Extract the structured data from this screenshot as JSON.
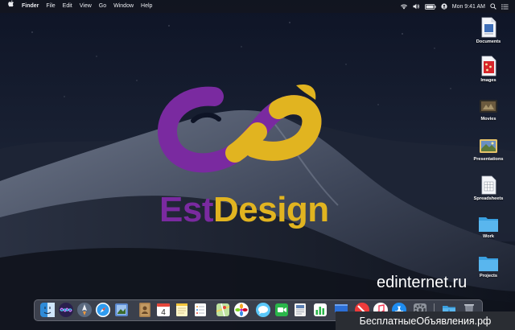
{
  "menubar": {
    "apple_icon": "apple-icon",
    "items": [
      "Finder",
      "File",
      "Edit",
      "View",
      "Go",
      "Window",
      "Help"
    ],
    "clock": "Mon 9:41 AM"
  },
  "desktop": {
    "icons": [
      {
        "label": "Documents"
      },
      {
        "label": "Images"
      },
      {
        "label": "Movies"
      },
      {
        "label": "Presentations"
      },
      {
        "label": "Spreadsheets"
      },
      {
        "label": "Work"
      },
      {
        "label": "Projects"
      }
    ]
  },
  "logo": {
    "part1": "Est",
    "part2": "Design",
    "colors": {
      "purple": "#7a2aa0",
      "gold": "#e1b420"
    }
  },
  "site_text": "edinternet.ru",
  "dock": {
    "apps": [
      "finder-icon",
      "siri-icon",
      "launchpad-icon",
      "safari-icon",
      "preview-icon",
      "contacts-icon",
      "calendar-icon",
      "notes-icon",
      "reminders-icon",
      "maps-icon",
      "photos-icon",
      "messages-icon",
      "facetime-icon",
      "news-icon",
      "numbers-icon",
      "keynote-icon",
      "news-block-icon",
      "music-icon",
      "app-store-icon",
      "system-preferences-icon",
      "downloads-folder-icon",
      "trash-icon"
    ],
    "calendar_day": "4"
  },
  "watermark": "БесплатныеОбъявления.рф"
}
